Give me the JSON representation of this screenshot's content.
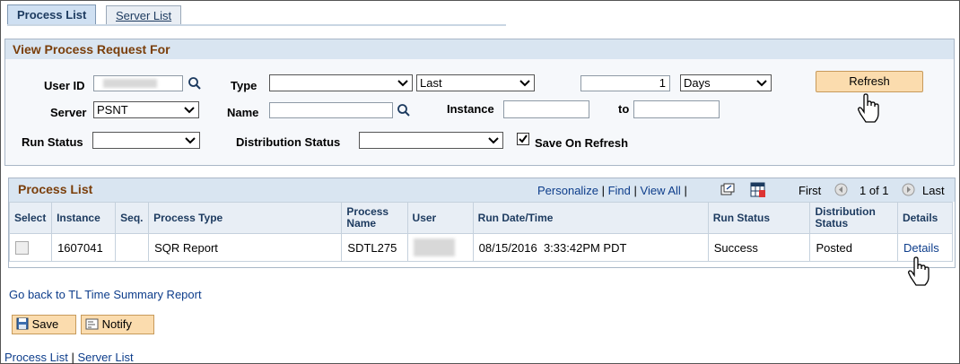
{
  "tabs": {
    "process_list": "Process List",
    "server_list": "Server List"
  },
  "filter": {
    "title": "View Process Request For",
    "user_id_label": "User ID",
    "user_id_value": "",
    "type_label": "Type",
    "type_value": "",
    "range_select": "Last",
    "range_number": "1",
    "range_unit": "Days",
    "refresh_label": "Refresh",
    "server_label": "Server",
    "server_value": "PSNT",
    "name_label": "Name",
    "name_value": "",
    "instance_label": "Instance",
    "instance_from": "",
    "to_label": "to",
    "instance_to": "",
    "run_status_label": "Run Status",
    "run_status_value": "",
    "dist_status_label": "Distribution Status",
    "dist_status_value": "",
    "save_on_refresh_label": "Save On Refresh",
    "save_on_refresh_checked": true
  },
  "grid": {
    "title": "Process List",
    "personalize": "Personalize",
    "sep1": "|",
    "find": "Find",
    "sep2": "|",
    "view_all": "View All",
    "sep3": "|",
    "first": "First",
    "range": "1 of 1",
    "last": "Last",
    "columns": {
      "select": "Select",
      "instance": "Instance",
      "seq": "Seq.",
      "process_type": "Process Type",
      "process_name": "Process Name",
      "user": "User",
      "run_datetime": "Run Date/Time",
      "run_status": "Run Status",
      "dist_status": "Distribution Status",
      "details": "Details"
    },
    "rows": [
      {
        "instance": "1607041",
        "seq": "",
        "process_type": "SQR Report",
        "process_name": "SDTL275",
        "user": "",
        "run_datetime": "08/15/2016  3:33:42PM PDT",
        "run_status": "Success",
        "dist_status": "Posted",
        "details": "Details"
      }
    ]
  },
  "footer": {
    "go_back": "Go back to TL Time Summary Report",
    "save": "Save",
    "notify": "Notify",
    "process_list_link": "Process List",
    "sep": "|",
    "server_list_link": "Server List"
  },
  "colors": {
    "accent_title": "#7a3e0a",
    "link": "#0d3d8b",
    "button_bg": "#fbdcae",
    "header_bg": "#d9e5f1"
  }
}
